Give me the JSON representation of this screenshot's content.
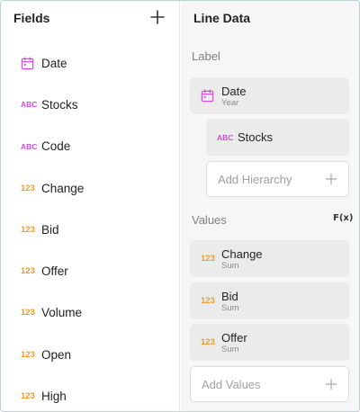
{
  "fields_panel": {
    "title": "Fields",
    "add_icon": "plus-icon",
    "items": [
      {
        "type_label": "",
        "type": "date",
        "icon": "calendar-icon",
        "name": "Date"
      },
      {
        "type_label": "ABC",
        "type": "text",
        "icon": "text-type-icon",
        "name": "Stocks"
      },
      {
        "type_label": "ABC",
        "type": "text",
        "icon": "text-type-icon",
        "name": "Code"
      },
      {
        "type_label": "123",
        "type": "number",
        "icon": "number-type-icon",
        "name": "Change"
      },
      {
        "type_label": "123",
        "type": "number",
        "icon": "number-type-icon",
        "name": "Bid"
      },
      {
        "type_label": "123",
        "type": "number",
        "icon": "number-type-icon",
        "name": "Offer"
      },
      {
        "type_label": "123",
        "type": "number",
        "icon": "number-type-icon",
        "name": "Volume"
      },
      {
        "type_label": "123",
        "type": "number",
        "icon": "number-type-icon",
        "name": "Open"
      },
      {
        "type_label": "123",
        "type": "number",
        "icon": "number-type-icon",
        "name": "High"
      }
    ]
  },
  "data_panel": {
    "title": "Line Data",
    "label_section": {
      "heading": "Label",
      "items": [
        {
          "type": "date",
          "icon": "calendar-icon",
          "name": "Date",
          "sub": "Year"
        },
        {
          "type": "text",
          "type_label": "ABC",
          "name": "Stocks",
          "sub": ""
        }
      ],
      "add_placeholder": "Add Hierarchy"
    },
    "values_section": {
      "heading": "Values",
      "fx_label": "F(x)",
      "items": [
        {
          "type_label": "123",
          "name": "Change",
          "sub": "Sum"
        },
        {
          "type_label": "123",
          "name": "Bid",
          "sub": "Sum"
        },
        {
          "type_label": "123",
          "name": "Offer",
          "sub": "Sum"
        }
      ],
      "add_placeholder": "Add Values"
    }
  },
  "colors": {
    "text_type": "#d44adf",
    "number_type": "#f29a2b",
    "date_type": "#d44adf",
    "card_bg": "#ebebeb",
    "panel_bg": "#f6f6f6"
  }
}
